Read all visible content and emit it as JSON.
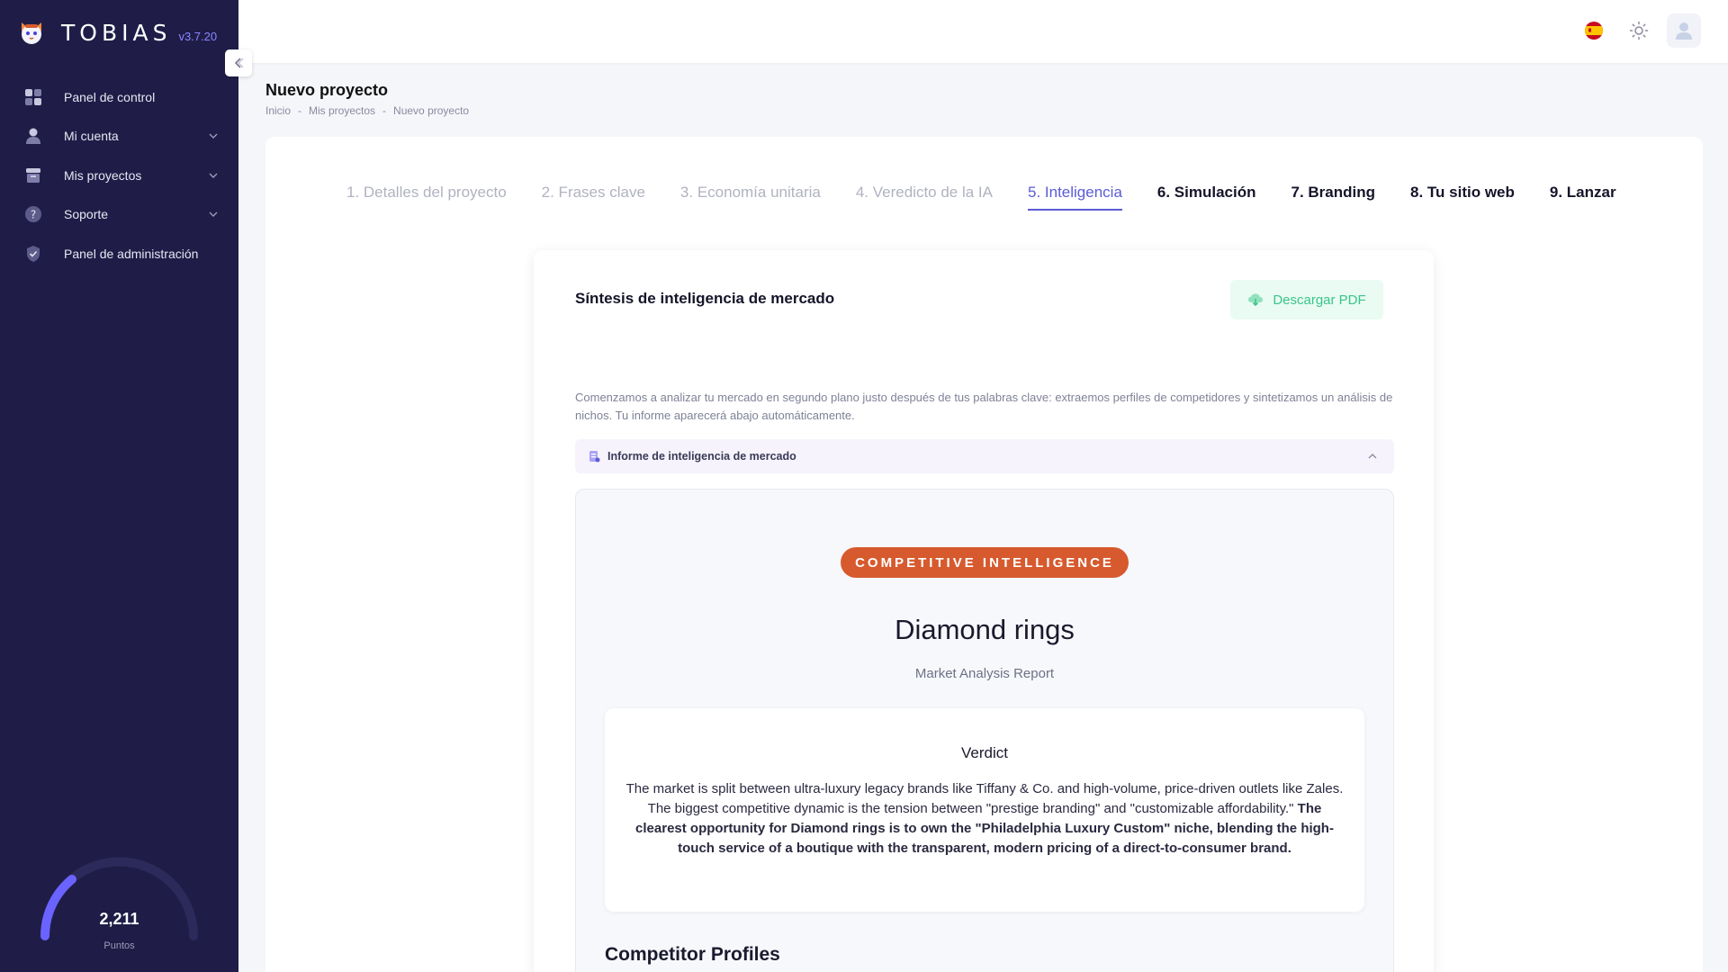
{
  "brand": {
    "name": "TOBIAS",
    "version": "v3.7.20"
  },
  "sidebar": {
    "items": [
      {
        "label": "Panel de control",
        "icon": "dashboard-icon",
        "has_chevron": false
      },
      {
        "label": "Mi cuenta",
        "icon": "user-icon",
        "has_chevron": true
      },
      {
        "label": "Mis proyectos",
        "icon": "projects-icon",
        "has_chevron": true
      },
      {
        "label": "Soporte",
        "icon": "help-icon",
        "has_chevron": true
      },
      {
        "label": "Panel de administración",
        "icon": "shield-check-icon",
        "has_chevron": false
      }
    ],
    "points": {
      "value": "2,211",
      "label": "Puntos"
    }
  },
  "header": {
    "icons": [
      "spain-flag-icon",
      "sun-icon",
      "user-avatar-icon"
    ]
  },
  "page": {
    "title": "Nuevo proyecto",
    "breadcrumb": [
      "Inicio",
      "-",
      "Mis proyectos",
      "-",
      "Nuevo proyecto"
    ]
  },
  "steps": [
    {
      "label": "1. Detalles del proyecto",
      "state": "done"
    },
    {
      "label": "2. Frases clave",
      "state": "done"
    },
    {
      "label": "3. Economía unitaria",
      "state": "done"
    },
    {
      "label": "4. Veredicto de la IA",
      "state": "done"
    },
    {
      "label": "5. Inteligencia",
      "state": "active"
    },
    {
      "label": "6. Simulación",
      "state": "future"
    },
    {
      "label": "7. Branding",
      "state": "future"
    },
    {
      "label": "8. Tu sitio web",
      "state": "future"
    },
    {
      "label": "9. Lanzar",
      "state": "future"
    }
  ],
  "intel": {
    "title": "Síntesis de inteligencia de mercado",
    "pdf_button": "Descargar PDF",
    "description": "Comenzamos a analizar tu mercado en segundo plano justo después de tus palabras clave: extraemos perfiles de competidores y sintetizamos un análisis de nichos. Tu informe aparecerá abajo automáticamente.",
    "accordion_label": "Informe de inteligencia de mercado"
  },
  "report": {
    "badge": "COMPETITIVE INTELLIGENCE",
    "title": "Diamond rings",
    "subtitle": "Market Analysis Report",
    "verdict_title": "Verdict",
    "verdict_text": "The market is split between ultra-luxury legacy brands like Tiffany & Co. and high-volume, price-driven outlets like Zales. The biggest competitive dynamic is the tension between \"prestige branding\" and \"customizable affordability.\"",
    "verdict_bold": "The clearest opportunity for Diamond rings is to own the \"Philadelphia Luxury Custom\" niche, blending the high-touch service of a boutique with the transparent, modern pricing of a direct-to-consumer brand.",
    "competitors_title": "Competitor Profiles"
  },
  "colors": {
    "sidebar_bg": "#1f1d47",
    "accent": "#5b5bd6",
    "badge": "#d75a2f",
    "pdf_green": "#3cc489"
  }
}
